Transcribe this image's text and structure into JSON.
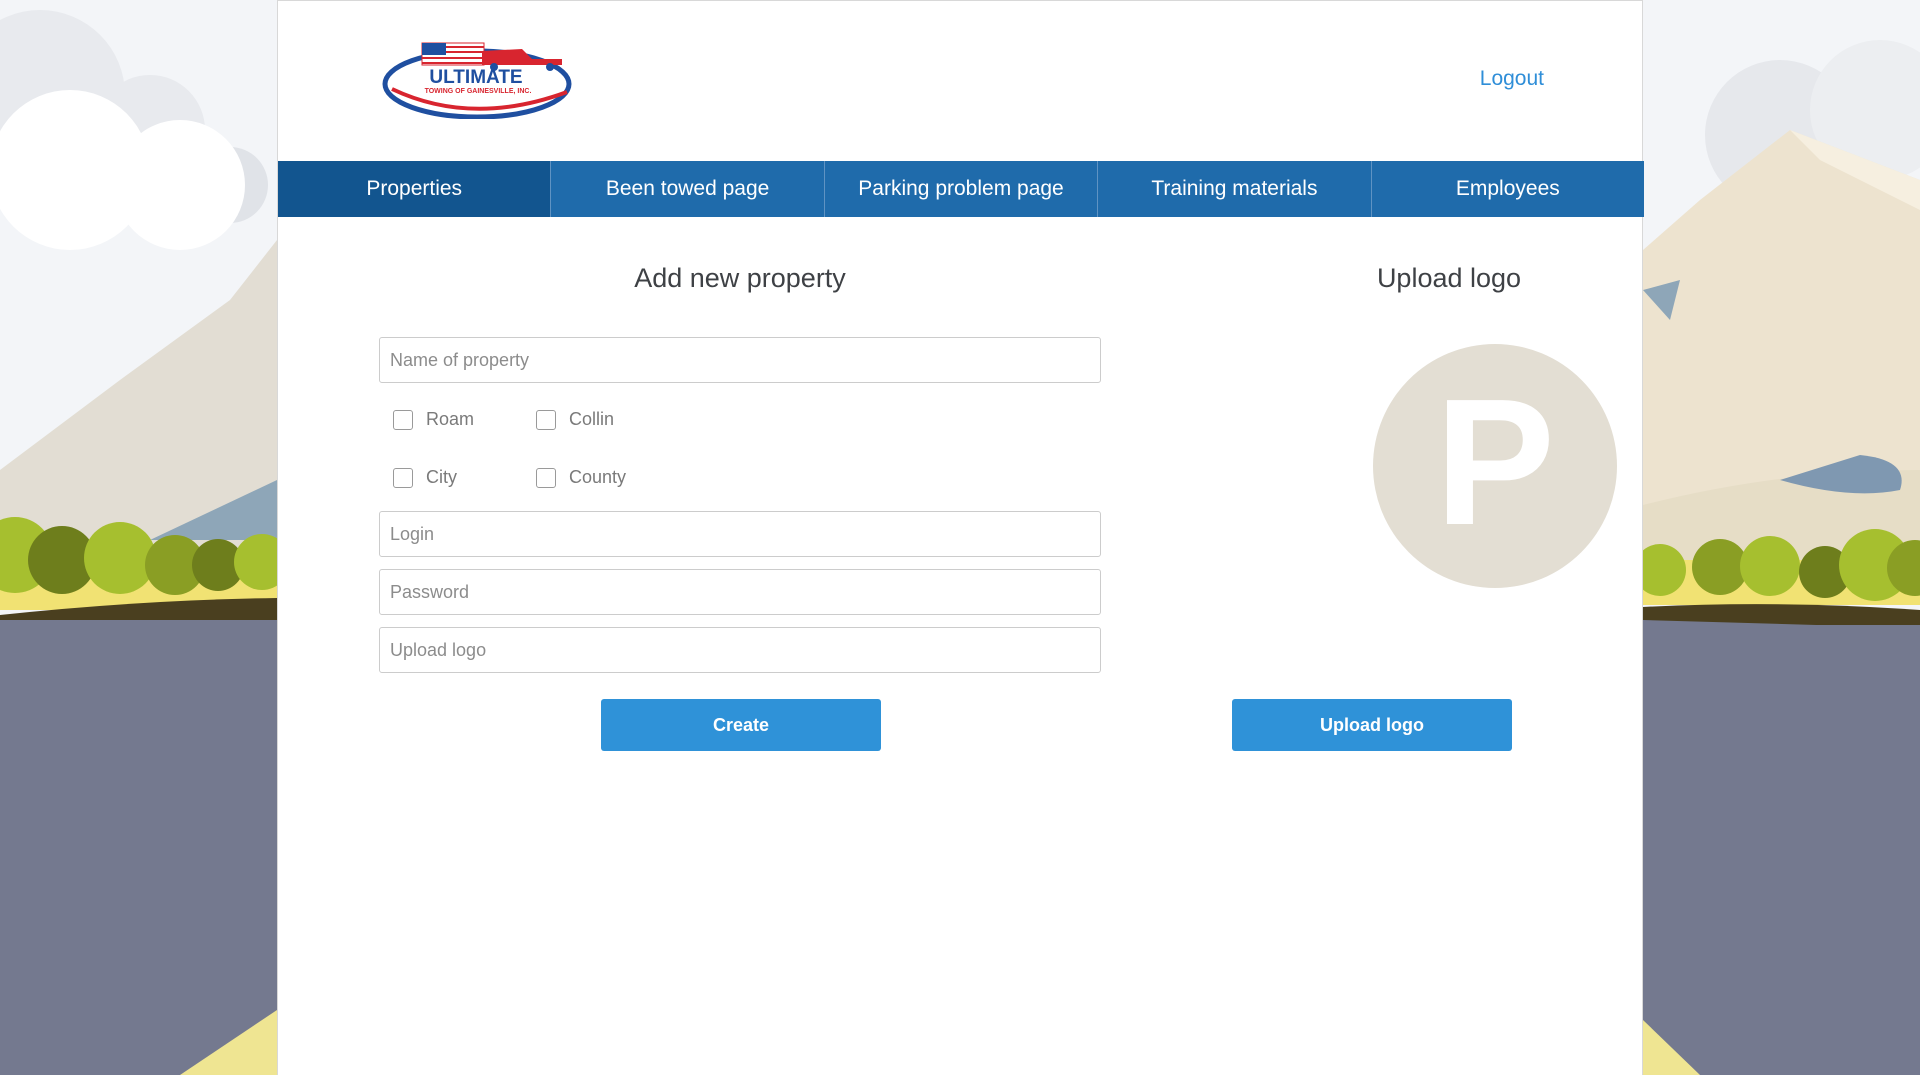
{
  "header": {
    "logo": {
      "brand": "ULTIMATE",
      "tagline": "TOWING OF GAINESVILLE, INC."
    },
    "logout_label": "Logout"
  },
  "nav": {
    "items": [
      {
        "label": "Properties",
        "active": true
      },
      {
        "label": "Been towed page",
        "active": false
      },
      {
        "label": "Parking problem page",
        "active": false
      },
      {
        "label": "Training materials",
        "active": false
      },
      {
        "label": "Employees",
        "active": false
      }
    ]
  },
  "form": {
    "title": "Add new property",
    "name_placeholder": "Name of property",
    "checkboxes": [
      {
        "label": "Roam",
        "checked": false
      },
      {
        "label": "Collin",
        "checked": false
      },
      {
        "label": "City",
        "checked": false
      },
      {
        "label": "County",
        "checked": false
      }
    ],
    "login_placeholder": "Login",
    "password_placeholder": "Password",
    "upload_placeholder": "Upload logo",
    "create_label": "Create"
  },
  "upload": {
    "title": "Upload logo",
    "placeholder_letter": "P",
    "button_label": "Upload logo"
  },
  "colors": {
    "nav": "#1f6bab",
    "nav_active": "#12558f",
    "button": "#2f92d8",
    "link": "#2f8ed8",
    "logo_circle": "#e3ded3"
  }
}
